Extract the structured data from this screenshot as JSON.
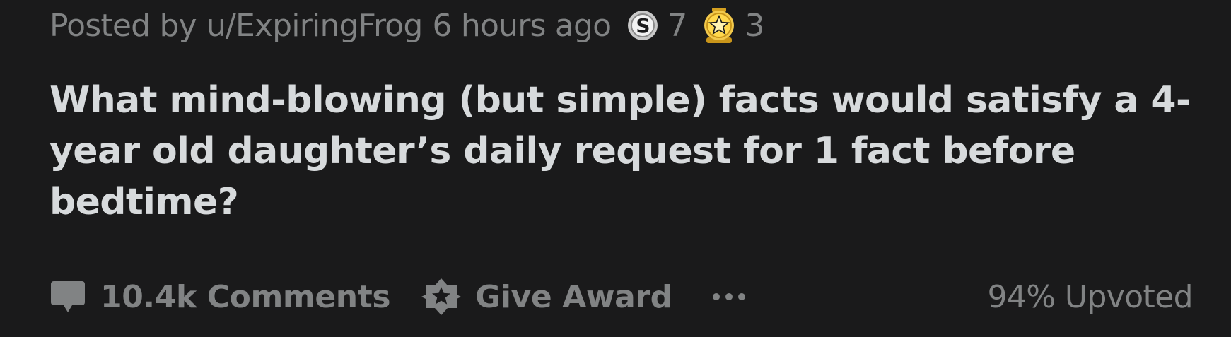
{
  "post": {
    "meta": {
      "posted_by_text": "Posted by",
      "author": "u/ExpiringFrog",
      "time_ago": "6 hours ago"
    },
    "awards": [
      {
        "icon": "silver-award-icon",
        "count": "7"
      },
      {
        "icon": "gold-award-icon",
        "count": "3"
      }
    ],
    "title": "What mind-blowing (but simple) facts would satisfy a 4-year old daughter’s daily request for 1 fact before bedtime?",
    "actions": {
      "comments_label": "10.4k Comments",
      "give_award_label": "Give Award",
      "more_icon": "more-options-icon"
    },
    "upvote_ratio": "94% Upvoted"
  },
  "colors": {
    "background": "#1a1a1b",
    "text_primary": "#d7dadc",
    "text_muted": "#818384",
    "gold": "#f2c94c"
  }
}
